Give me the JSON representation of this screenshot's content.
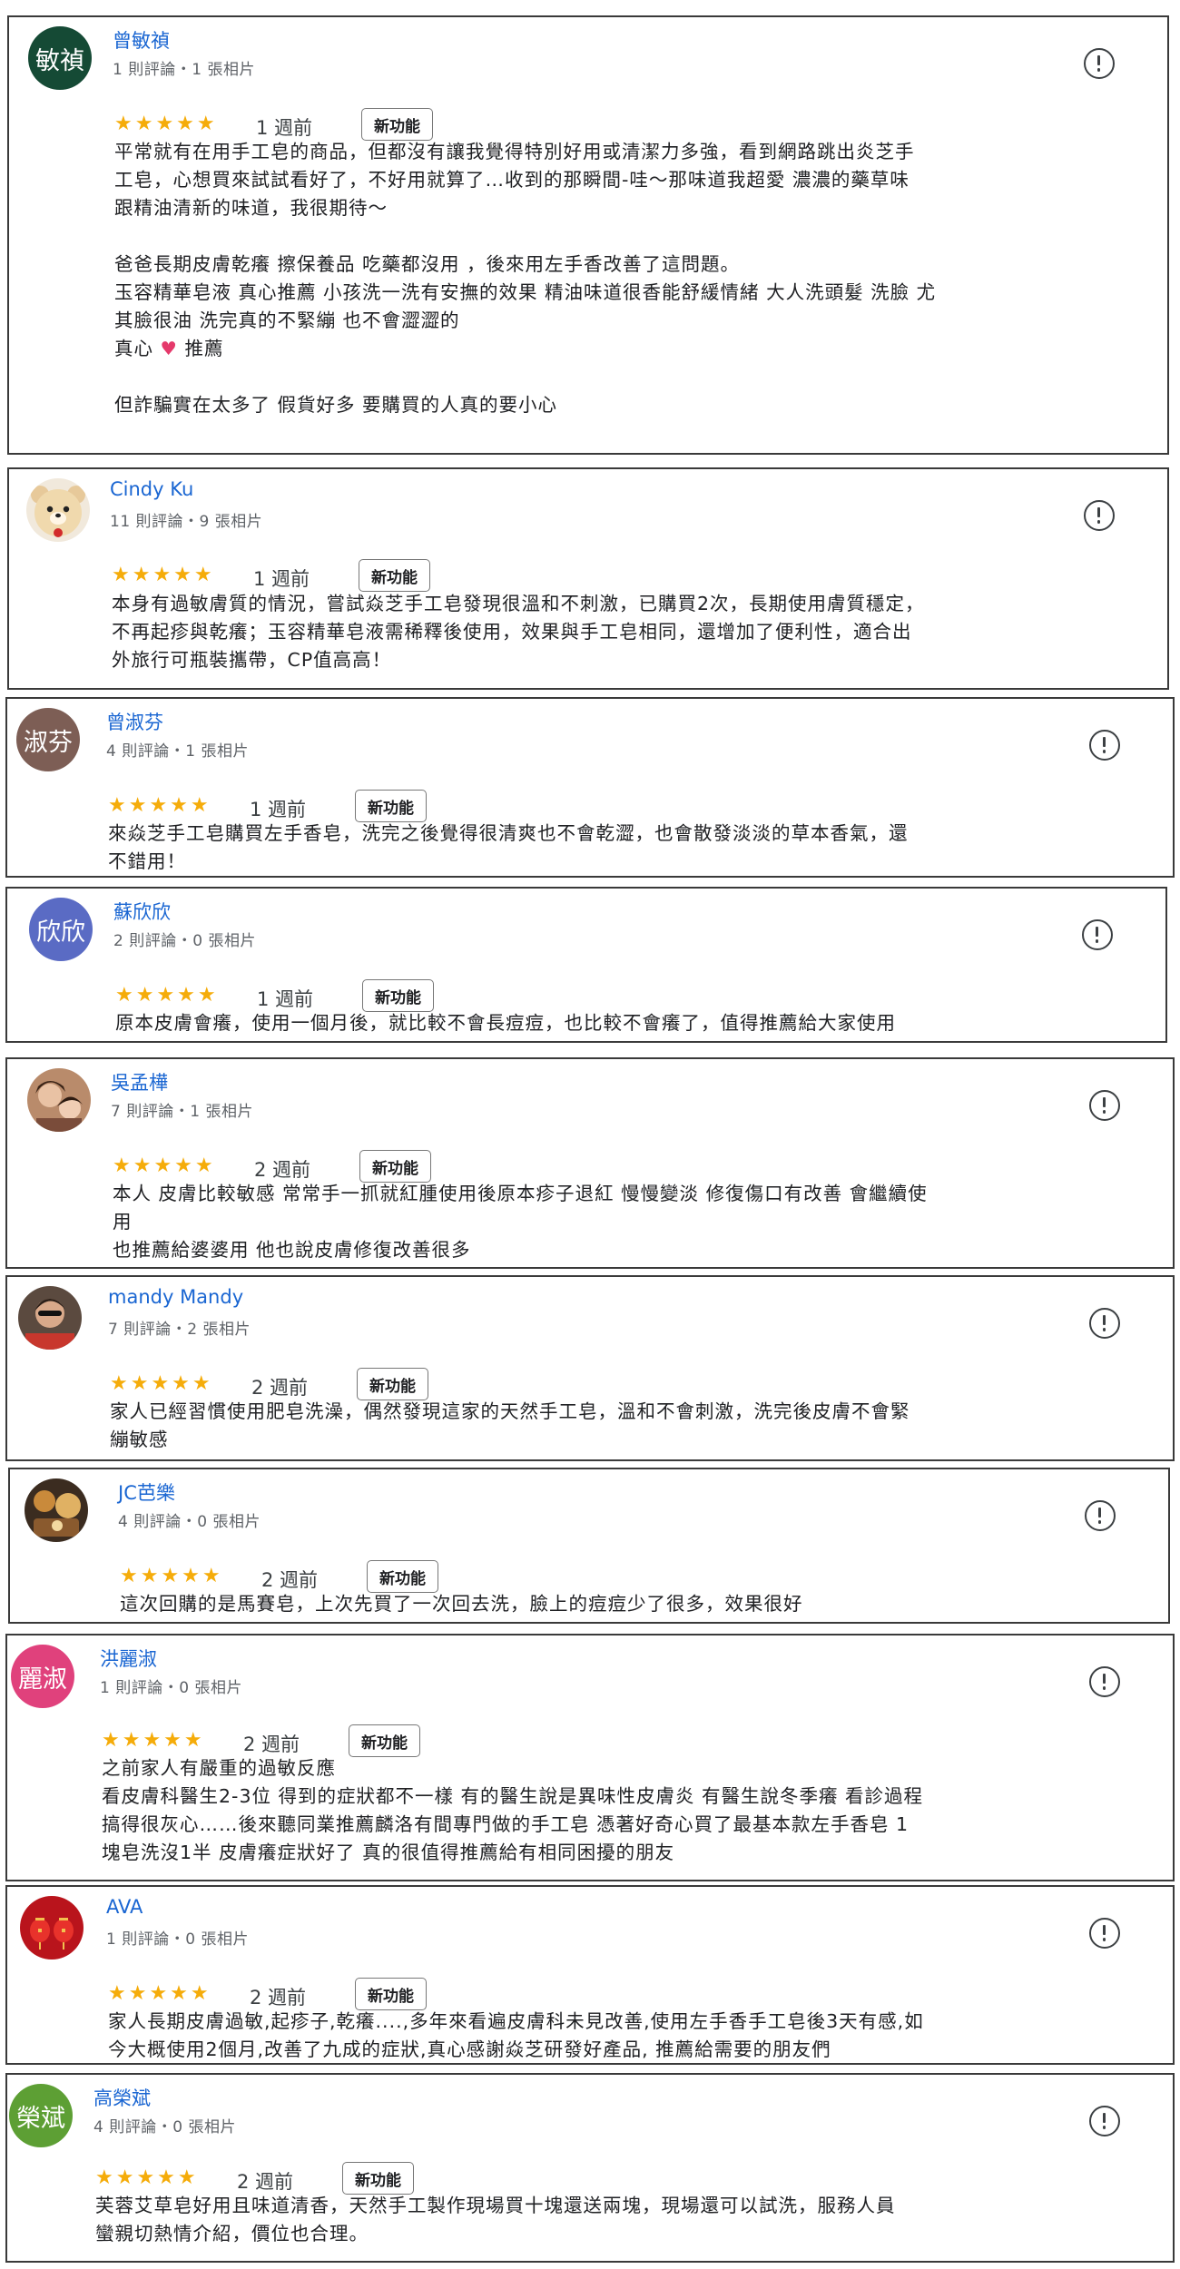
{
  "new_feature_label": "新功能",
  "reviews": [
    {
      "name": "曾敏禎",
      "meta": "1 則評論・1 張相片",
      "avatar_text": "敏禎",
      "avatar_color": "#154a35",
      "rating": "★★★★★",
      "time": "1 週前",
      "lines": [
        "平常就有在用手工皂的商品，但都沒有讓我覺得特別好用或清潔力多強，看到網路跳出炎芝手",
        "工皂，心想買來試試看好了，不好用就算了…收到的那瞬間-哇～那味道我超愛 濃濃的藥草味",
        "跟精油清新的味道，我很期待～",
        "",
        "爸爸長期皮膚乾癢 擦保養品 吃藥都沒用 ，後來用左手香改善了這問題。",
        "玉容精華皂液 真心推薦 小孩洗一洗有安撫的效果 精油味道很香能舒緩情緒 大人洗頭髮 洗臉 尤",
        "其臉很油 洗完真的不緊繃 也不會澀澀的",
        "真心 推薦",
        "",
        "但詐騙實在太多了 假貨好多 要購買的人真的要小心"
      ]
    },
    {
      "name": "Cindy Ku",
      "meta": "11 則評論・9 張相片",
      "avatar_icon": "bear-avatar-icon",
      "rating": "★★★★★",
      "time": "1 週前",
      "lines": [
        "本身有過敏膚質的情況，嘗試焱芝手工皂發現很溫和不刺激，已購買2次，長期使用膚質穩定，",
        "不再起疹與乾癢；玉容精華皂液需稀釋後使用，效果與手工皂相同，還增加了便利性，適合出",
        "外旅行可瓶裝攜帶，CP值高高！"
      ]
    },
    {
      "name": "曾淑芬",
      "meta": "4 則評論・1 張相片",
      "avatar_text": "淑芬",
      "avatar_color": "#7d5e55",
      "rating": "★★★★★",
      "time": "1 週前",
      "lines": [
        "來焱芝手工皂購買左手香皂，洗完之後覺得很清爽也不會乾澀，也會散發淡淡的草本香氣，還",
        "不錯用！"
      ]
    },
    {
      "name": "蘇欣欣",
      "meta": "2 則評論・0 張相片",
      "avatar_text": "欣欣",
      "avatar_color": "#5a6bc4",
      "rating": "★★★★★",
      "time": "1 週前",
      "lines": [
        "原本皮膚會癢，使用一個月後，就比較不會長痘痘，也比較不會癢了，值得推薦給大家使用"
      ]
    },
    {
      "name": "吳孟樺",
      "meta": "7 則評論・1 張相片",
      "avatar_icon": "couple-photo-avatar-icon",
      "rating": "★★★★★",
      "time": "2 週前",
      "lines": [
        "本人 皮膚比較敏感 常常手一抓就紅腫使用後原本疹子退紅 慢慢變淡 修復傷口有改善 會繼續使",
        "用",
        "也推薦給婆婆用 他也說皮膚修復改善很多"
      ]
    },
    {
      "name": "mandy Mandy",
      "meta": "7 則評論・2 張相片",
      "avatar_icon": "person-photo-avatar-icon",
      "rating": "★★★★★",
      "time": "2 週前",
      "lines": [
        "家人已經習慣使用肥皂洗澡，偶然發現這家的天然手工皂，溫和不會刺激，洗完後皮膚不會緊",
        "繃敏感"
      ]
    },
    {
      "name": "JC芭樂",
      "meta": "4 則評論・0 張相片",
      "avatar_icon": "food-photo-avatar-icon",
      "rating": "★★★★★",
      "time": "2 週前",
      "lines": [
        "這次回購的是馬賽皂，上次先買了一次回去洗，臉上的痘痘少了很多，效果很好"
      ]
    },
    {
      "name": "洪麗淑",
      "meta": "1 則評論・0 張相片",
      "avatar_text": "麗淑",
      "avatar_color": "#e0417c",
      "rating": "★★★★★",
      "time": "2 週前",
      "lines": [
        "之前家人有嚴重的過敏反應",
        "看皮膚科醫生2-3位 得到的症狀都不一樣 有的醫生說是異味性皮膚炎 有醫生說冬季癢 看診過程",
        "搞得很灰心……後來聽同業推薦麟洛有間專門做的手工皂 憑著好奇心買了最基本款左手香皂 1",
        "塊皂洗沒1半 皮膚癢症狀好了 真的很值得推薦給有相同困擾的朋友"
      ]
    },
    {
      "name": "AVA",
      "meta": "1 則評論・0 張相片",
      "avatar_icon": "red-lantern-avatar-icon",
      "rating": "★★★★★",
      "time": "2 週前",
      "lines": [
        "家人長期皮膚過敏,起疹子,乾癢....,多年來看遍皮膚科未見改善,使用左手香手工皂後3天有感,如",
        "今大概使用2個月,改善了九成的症狀,真心感謝焱芝研發好產品, 推薦給需要的朋友們"
      ]
    },
    {
      "name": "高榮斌",
      "meta": "4 則評論・0 張相片",
      "avatar_text": "榮斌",
      "avatar_color": "#5d9f34",
      "rating": "★★★★★",
      "time": "2 週前",
      "lines": [
        "芙蓉艾草皂好用且味道清香，天然手工製作現場買十塊還送兩塊，現場還可以試洗，服務人員",
        "蠻親切熱情介紹，價位也合理。"
      ]
    }
  ]
}
